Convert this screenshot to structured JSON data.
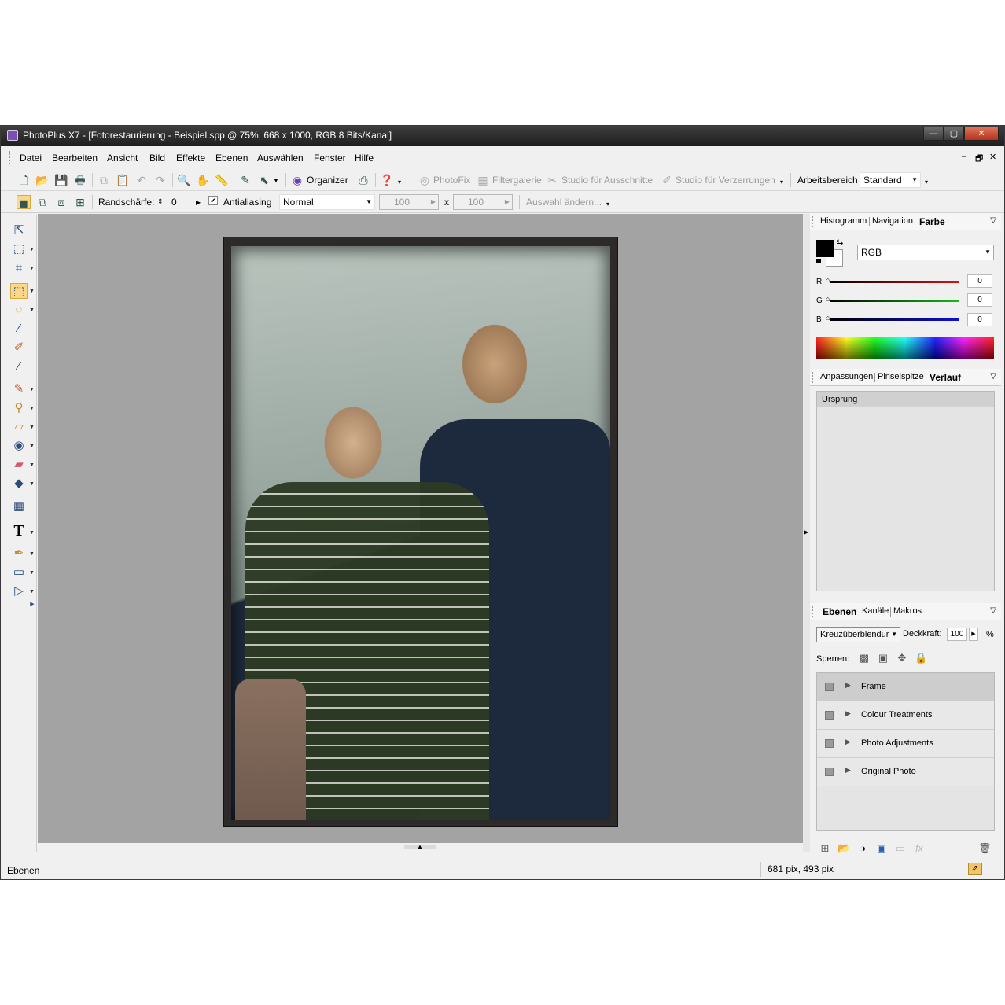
{
  "window": {
    "title": "PhotoPlus X7 - [Fotorestaurierung - Beispiel.spp @ 75%, 668 x 1000, RGB 8 Bits/Kanal]",
    "controls": {
      "minimize": "—",
      "maximize": "▢",
      "close": "✕"
    }
  },
  "menu": {
    "items": [
      "Datei",
      "Bearbeiten",
      "Ansicht",
      "Bild",
      "Effekte",
      "Ebenen",
      "Auswählen",
      "Fenster",
      "Hilfe"
    ],
    "mdi_controls": [
      "–",
      "🗗",
      "✕"
    ]
  },
  "toolbar1": {
    "organizer": "Organizer",
    "photofix": "PhotoFix",
    "filtergalerie": "Filtergalerie",
    "ausschnitte": "Studio für Ausschnitte",
    "verzerrungen": "Studio für Verzerrungen",
    "workspace_label": "Arbeitsbereich",
    "workspace_value": "Standard",
    "icons": [
      "new-document-icon",
      "open-folder-icon",
      "save-icon",
      "print-icon",
      "copy-icon",
      "paste-icon",
      "undo-icon",
      "redo-icon",
      "zoom-icon",
      "hand-icon",
      "ruler-icon",
      "eyedropper-icon",
      "select-arrow-icon",
      "organizer-icon",
      "export-icon",
      "help-icon"
    ]
  },
  "toolbar2": {
    "feather_label": "Randschärfe:",
    "feather_value": "0",
    "antialias_label": "Antialiasing",
    "antialias_check": "✔",
    "blend_mode": "Normal",
    "width_value": "100",
    "x_sep": "x",
    "height_value": "100",
    "modify_selection": "Auswahl ändern..."
  },
  "panels": {
    "color": {
      "tabs": [
        "Histogramm",
        "Navigation",
        "Farbe"
      ],
      "mode": "RGB",
      "channels": [
        {
          "label": "R",
          "value": "0",
          "color": "#d01010"
        },
        {
          "label": "G",
          "value": "0",
          "color": "#10a010"
        },
        {
          "label": "B",
          "value": "0",
          "color": "#1010c0"
        }
      ]
    },
    "history": {
      "tabs": [
        "Anpassungen",
        "Pinselspitze",
        "Verlauf"
      ],
      "items": [
        "Ursprung"
      ]
    },
    "layers": {
      "tabs": [
        "Ebenen",
        "Kanäle",
        "Makros"
      ],
      "blend_mode": "Kreuzüberblendur",
      "opacity_label": "Deckkraft:",
      "opacity_value": "100",
      "opacity_unit": "%",
      "lock_label": "Sperren:",
      "layers": [
        {
          "name": "Frame",
          "selected": true
        },
        {
          "name": "Colour Treatments",
          "selected": false
        },
        {
          "name": "Photo Adjustments",
          "selected": false
        },
        {
          "name": "Original Photo",
          "selected": false
        }
      ]
    }
  },
  "status": {
    "left": "Ebenen",
    "coords": "681 pix, 493 pix"
  }
}
